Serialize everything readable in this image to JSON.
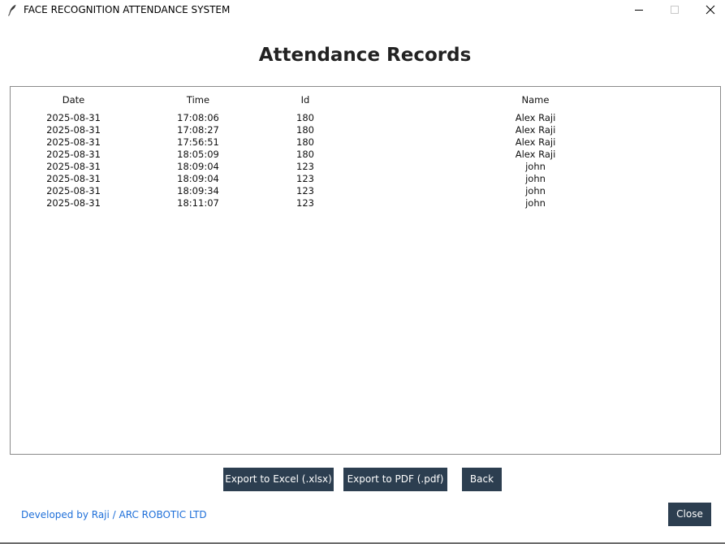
{
  "window": {
    "title": "FACE RECOGNITION ATTENDANCE SYSTEM",
    "icon": "feather-icon"
  },
  "page": {
    "title": "Attendance Records"
  },
  "table": {
    "columns": [
      "Date",
      "Time",
      "Id",
      "Name"
    ],
    "rows": [
      [
        "2025-08-31",
        "17:08:06",
        "180",
        "Alex Raji"
      ],
      [
        "2025-08-31",
        "17:08:27",
        "180",
        "Alex Raji"
      ],
      [
        "2025-08-31",
        "17:56:51",
        "180",
        "Alex Raji"
      ],
      [
        "2025-08-31",
        "18:05:09",
        "180",
        "Alex Raji"
      ],
      [
        "2025-08-31",
        "18:09:04",
        "123",
        "john"
      ],
      [
        "2025-08-31",
        "18:09:04",
        "123",
        "john"
      ],
      [
        "2025-08-31",
        "18:09:34",
        "123",
        "john"
      ],
      [
        "2025-08-31",
        "18:11:07",
        "123",
        "john"
      ]
    ]
  },
  "actions": {
    "export_excel": "Export to Excel (.xlsx)",
    "export_pdf": "Export to PDF (.pdf)",
    "back": "Back",
    "close": "Close"
  },
  "footer": {
    "credit": "Developed by Raji / ARC ROBOTIC LTD"
  },
  "colors": {
    "button_bg": "#2c3e50",
    "button_text": "#ffffff",
    "link": "#1e6fd9"
  }
}
